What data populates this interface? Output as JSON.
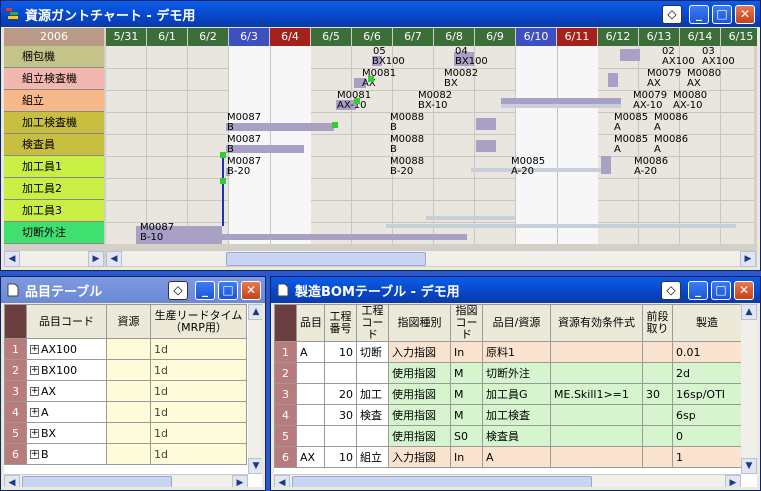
{
  "gantt": {
    "title": "資源ガントチャート - デモ用",
    "year": "2006",
    "dates": [
      {
        "label": "5/31",
        "color": "#3b6e38"
      },
      {
        "label": "6/1",
        "color": "#3b6e38"
      },
      {
        "label": "6/2",
        "color": "#3b6e38"
      },
      {
        "label": "6/3",
        "color": "#3e4fc0"
      },
      {
        "label": "6/4",
        "color": "#a3221c"
      },
      {
        "label": "6/5",
        "color": "#3b6e38"
      },
      {
        "label": "6/6",
        "color": "#3b6e38"
      },
      {
        "label": "6/7",
        "color": "#3b6e38"
      },
      {
        "label": "6/8",
        "color": "#3b6e38"
      },
      {
        "label": "6/9",
        "color": "#3b6e38"
      },
      {
        "label": "6/10",
        "color": "#3e4fc0"
      },
      {
        "label": "6/11",
        "color": "#a3221c"
      },
      {
        "label": "6/12",
        "color": "#3b6e38"
      },
      {
        "label": "6/13",
        "color": "#3b6e38"
      },
      {
        "label": "6/14",
        "color": "#3b6e38"
      },
      {
        "label": "6/15",
        "color": "#3b6e38"
      }
    ],
    "resources": [
      {
        "label": "梱包機",
        "color": "#c4c48a"
      },
      {
        "label": "組立検査機",
        "color": "#f2b8b0"
      },
      {
        "label": "組立",
        "color": "#f7b98a"
      },
      {
        "label": "加工検査機",
        "color": "#c8be40"
      },
      {
        "label": "検査員",
        "color": "#c8be40"
      },
      {
        "label": "加工員1",
        "color": "#c9ee44"
      },
      {
        "label": "加工員2",
        "color": "#c9ee44"
      },
      {
        "label": "加工員3",
        "color": "#c9ee44"
      },
      {
        "label": "切断外注",
        "color": "#40e070"
      }
    ],
    "labels": {
      "l1": "05",
      "l1b": "BX100",
      "l2": "04",
      "l2b": "BX100",
      "l3": "02",
      "l3b": "AX100",
      "l4": "03",
      "l4b": "AX100",
      "l5": "M0081",
      "l5b": "AX",
      "l6": "M0082",
      "l6b": "BX",
      "l7": "M0079",
      "l7b": "AX",
      "l8": "M0080",
      "l8b": "AX",
      "l9": "M0081",
      "l9b": "AX-10",
      "l10": "M0082",
      "l10b": "BX-10",
      "l11": "M0079",
      "l11b": "AX-10",
      "l12": "M0080",
      "l12b": "AX-10",
      "l13": "M0087",
      "l13b": "B",
      "l14": "M0088",
      "l14b": "B",
      "l15": "M0085",
      "l15b": "A",
      "l16": "M0086",
      "l16b": "A",
      "l17": "M0087",
      "l17b": "B",
      "l18": "M0088",
      "l18b": "B",
      "l19": "M0085",
      "l19b": "A",
      "l20": "M0086",
      "l20b": "A",
      "l21": "M0087",
      "l21b": "B-20",
      "l22": "M0088",
      "l22b": "B-20",
      "l23": "M0085",
      "l23b": "A-20",
      "l24": "M0086",
      "l24b": "A-20",
      "l25": "M0087",
      "l25b": "B-10"
    }
  },
  "items": {
    "title": "品目テーブル",
    "columns": [
      "品目コード",
      "資源",
      "生産リードタイム（MRP用）"
    ],
    "rows": [
      {
        "no": "1",
        "code": "AX100",
        "resource": "",
        "lead": "1d"
      },
      {
        "no": "2",
        "code": "BX100",
        "resource": "",
        "lead": "1d"
      },
      {
        "no": "3",
        "code": "AX",
        "resource": "",
        "lead": "1d"
      },
      {
        "no": "4",
        "code": "A",
        "resource": "",
        "lead": "1d"
      },
      {
        "no": "5",
        "code": "BX",
        "resource": "",
        "lead": "1d"
      },
      {
        "no": "6",
        "code": "B",
        "resource": "",
        "lead": "1d"
      }
    ]
  },
  "bom": {
    "title": "製造BOMテーブル - デモ用",
    "columns": [
      "品目",
      "工程番号",
      "工程コード",
      "指図種別",
      "指図コード",
      "品目/資源",
      "資源有効条件式",
      "前段取り",
      "製造"
    ],
    "rows": [
      {
        "no": "1",
        "item": "A",
        "proc_no": "10",
        "proc_code": "切断",
        "kind": "入力指図",
        "code": "In",
        "res": "原料1",
        "cond": "",
        "setup": "",
        "mfg": "0.01",
        "tone": "bpeach"
      },
      {
        "no": "2",
        "item": "",
        "proc_no": "",
        "proc_code": "",
        "kind": "使用指図",
        "code": "M",
        "res": "切断外注",
        "cond": "",
        "setup": "",
        "mfg": "2d",
        "tone": "bgreen"
      },
      {
        "no": "3",
        "item": "",
        "proc_no": "20",
        "proc_code": "加工",
        "kind": "使用指図",
        "code": "M",
        "res": "加工員G",
        "cond": "ME.Skill1>=1",
        "setup": "30",
        "mfg": "16sp/OTI",
        "tone": "bgreen"
      },
      {
        "no": "4",
        "item": "",
        "proc_no": "30",
        "proc_code": "検査",
        "kind": "使用指図",
        "code": "M",
        "res": "加工検査",
        "cond": "",
        "setup": "",
        "mfg": "6sp",
        "tone": "bgreen"
      },
      {
        "no": "5",
        "item": "",
        "proc_no": "",
        "proc_code": "",
        "kind": "使用指図",
        "code": "S0",
        "res": "検査員",
        "cond": "",
        "setup": "",
        "mfg": "0",
        "tone": "bgreen"
      },
      {
        "no": "6",
        "item": "AX",
        "proc_no": "10",
        "proc_code": "組立",
        "kind": "入力指図",
        "code": "In",
        "res": "A",
        "cond": "",
        "setup": "",
        "mfg": "1",
        "tone": "bpeach"
      }
    ]
  }
}
